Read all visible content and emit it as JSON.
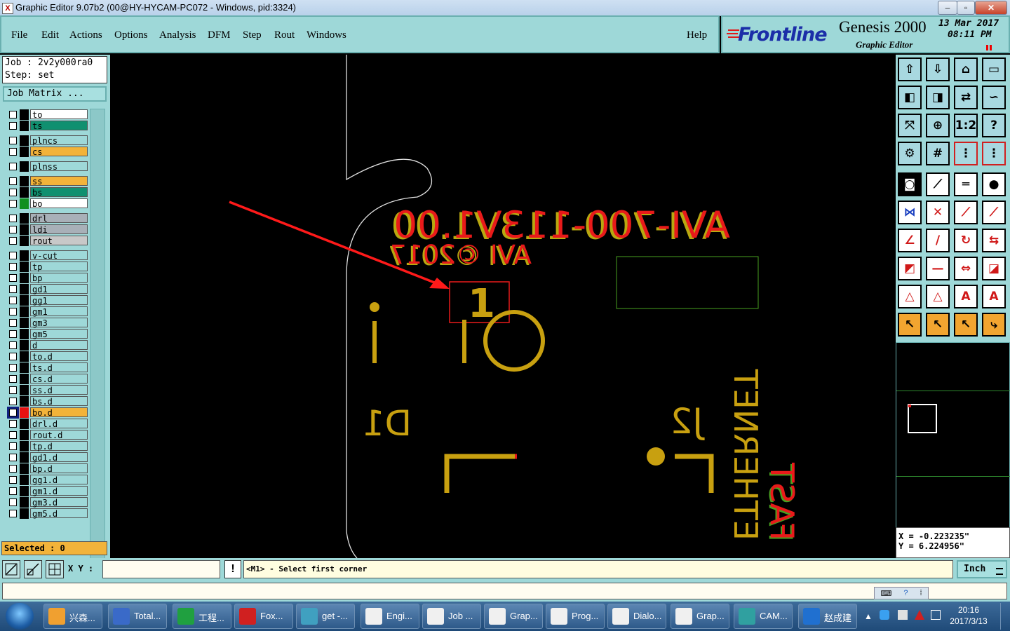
{
  "window": {
    "title": "Graphic Editor 9.07b2 (00@HY-HYCAM-PC072 - Windows, pid:3324)"
  },
  "menu": {
    "file": "File",
    "edit": "Edit",
    "actions": "Actions",
    "options": "Options",
    "analysis": "Analysis",
    "dfm": "DFM",
    "step": "Step",
    "rout": "Rout",
    "windows": "Windows",
    "help": "Help"
  },
  "brand": {
    "logo": "Frontline",
    "product": "Genesis 2000",
    "subtitle": "Graphic Editor",
    "date": "13 Mar 2017",
    "time": "08:11 PM"
  },
  "job": {
    "job_line": "Job : 2v2y000ra0",
    "step_line": "Step: set",
    "matrix_button": "Job Matrix ..."
  },
  "layers": [
    {
      "name": "to",
      "color": "#ffffff",
      "swatch": ""
    },
    {
      "name": "ts",
      "color": "#109070",
      "swatch": ""
    },
    {
      "name": "plncs",
      "color": "#9ed8d8",
      "swatch": ""
    },
    {
      "name": "cs",
      "color": "#f2b33a",
      "swatch": ""
    },
    {
      "name": "plnss",
      "color": "#9ed8d8",
      "swatch": ""
    },
    {
      "name": "ss",
      "color": "#f2b33a",
      "swatch": ""
    },
    {
      "name": "bs",
      "color": "#109070",
      "swatch": ""
    },
    {
      "name": "bo",
      "color": "#ffffff",
      "swatch": "#109020"
    },
    {
      "name": "drl",
      "color": "#a8b0b8",
      "swatch": ""
    },
    {
      "name": "ldi",
      "color": "#a8b0b8",
      "swatch": ""
    },
    {
      "name": "rout",
      "color": "#c8c8c8",
      "swatch": ""
    },
    {
      "name": "v-cut",
      "color": "#9ed8d8",
      "swatch": ""
    },
    {
      "name": "tp",
      "color": "#9ed8d8",
      "swatch": ""
    },
    {
      "name": "bp",
      "color": "#9ed8d8",
      "swatch": ""
    },
    {
      "name": "gd1",
      "color": "#9ed8d8",
      "swatch": ""
    },
    {
      "name": "gg1",
      "color": "#9ed8d8",
      "swatch": ""
    },
    {
      "name": "gm1",
      "color": "#9ed8d8",
      "swatch": ""
    },
    {
      "name": "gm3",
      "color": "#9ed8d8",
      "swatch": ""
    },
    {
      "name": "gm5",
      "color": "#9ed8d8",
      "swatch": ""
    },
    {
      "name": "d",
      "color": "#9ed8d8",
      "swatch": ""
    },
    {
      "name": "to.d",
      "color": "#9ed8d8",
      "swatch": ""
    },
    {
      "name": "ts.d",
      "color": "#9ed8d8",
      "swatch": ""
    },
    {
      "name": "cs.d",
      "color": "#9ed8d8",
      "swatch": ""
    },
    {
      "name": "ss.d",
      "color": "#9ed8d8",
      "swatch": ""
    },
    {
      "name": "bs.d",
      "color": "#9ed8d8",
      "swatch": ""
    },
    {
      "name": "bo.d",
      "color": "#f2b33a",
      "swatch": "#e81010"
    },
    {
      "name": "drl.d",
      "color": "#9ed8d8",
      "swatch": ""
    },
    {
      "name": "rout.d",
      "color": "#9ed8d8",
      "swatch": ""
    },
    {
      "name": "tp.d",
      "color": "#9ed8d8",
      "swatch": ""
    },
    {
      "name": "gd1.d",
      "color": "#9ed8d8",
      "swatch": ""
    },
    {
      "name": "bp.d",
      "color": "#9ed8d8",
      "swatch": ""
    },
    {
      "name": "gg1.d",
      "color": "#9ed8d8",
      "swatch": ""
    },
    {
      "name": "gm1.d",
      "color": "#9ed8d8",
      "swatch": ""
    },
    {
      "name": "gm3.d",
      "color": "#9ed8d8",
      "swatch": ""
    },
    {
      "name": "gm5.d",
      "color": "#9ed8d8",
      "swatch": ""
    }
  ],
  "selected": "Selected : 0",
  "pcb": {
    "red_line1": "AVI-700-113V1.00",
    "red_line2": "AVI ©2017",
    "pin1": "1",
    "d1": "D1",
    "j2": "J2",
    "ethernet": "ETHERNET",
    "fast": "FAST"
  },
  "coords": {
    "x": "X = -0.223235\"",
    "y": "Y = 6.224956\""
  },
  "command": {
    "xy_label": "X Y :",
    "xy_value": "",
    "prompt": "<M1> - Select first corner",
    "units": "Inch"
  },
  "tools": {
    "row1": [
      "move-up-icon",
      "move-down-icon",
      "home-icon",
      "window-icon"
    ],
    "row2": [
      "pan-left-icon",
      "pan-right-icon",
      "swap-icon",
      "redraw-icon"
    ],
    "row3": [
      "zoom-fit-icon",
      "zoom-center-icon",
      "scale-icon",
      "help-icon"
    ],
    "row4": [
      "settings-icon",
      "grid-icon",
      "snap-icon",
      "snap-alt-icon"
    ],
    "row5": [
      "pad-icon",
      "line-icon",
      "ruler-icon",
      "circle-icon"
    ],
    "row6": [
      "connect-icon",
      "intersect-icon",
      "point-icon",
      "point-alt-icon"
    ],
    "row7": [
      "angle-icon",
      "slope-icon",
      "arc-icon",
      "mirror-icon"
    ],
    "row8": [
      "node-icon",
      "midline-icon",
      "measure-icon",
      "shapes-icon"
    ],
    "row9": [
      "triangle-icon",
      "triangle-alt-icon",
      "a-icon",
      "a-alt-icon"
    ],
    "row10": [
      "pointer-icon",
      "select-icon",
      "select-alt-icon",
      "route-icon"
    ]
  },
  "taskbar": {
    "items": [
      "兴森...",
      "Total...",
      "工程...",
      "Fox...",
      "get -...",
      "Engi...",
      "Job ...",
      "Grap...",
      "Prog...",
      "Dialo...",
      "Grap...",
      "CAM...",
      "赵成建"
    ],
    "time": "20:16",
    "date": "2017/3/13"
  }
}
